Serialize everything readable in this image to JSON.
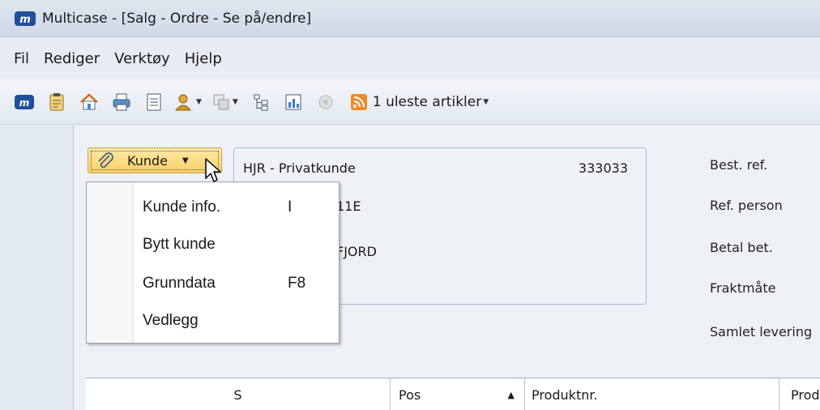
{
  "window": {
    "title": "Multicase - [Salg - Ordre - Se på/endre]"
  },
  "menubar": {
    "items": [
      "Fil",
      "Rediger",
      "Verktøy",
      "Hjelp"
    ]
  },
  "toolbar": {
    "icons": [
      "app-logo-icon",
      "clipboard-icon",
      "home-icon",
      "print-icon",
      "document-icon",
      "user-icon",
      "copy-icon",
      "tree-icon",
      "chart-icon",
      "disabled-circle-icon",
      "rss-icon"
    ],
    "rss_label": "1 uleste artikler"
  },
  "customer": {
    "button_label": "Kunde",
    "name": "HJR - Privatkunde",
    "number": "333033",
    "address_fragment": "11E",
    "city_fragment": "FJORD"
  },
  "right_labels": [
    "Best. ref.",
    "Ref. person",
    "Betal bet.",
    "Fraktmåte",
    "Samlet levering"
  ],
  "dropdown": {
    "items": [
      {
        "label": "Kunde info.",
        "shortcut": "I"
      },
      {
        "label": "Bytt kunde",
        "shortcut": ""
      },
      {
        "label": "Grunndata",
        "shortcut": "F8"
      },
      {
        "label": "Vedlegg",
        "shortcut": ""
      }
    ]
  },
  "grid": {
    "columns": [
      "S",
      "Pos",
      "Produktnr.",
      "Prod"
    ]
  },
  "colors": {
    "button_highlight": "#fbcf64",
    "rss_orange": "#f08a24",
    "app_blue": "#1f4f9c"
  }
}
